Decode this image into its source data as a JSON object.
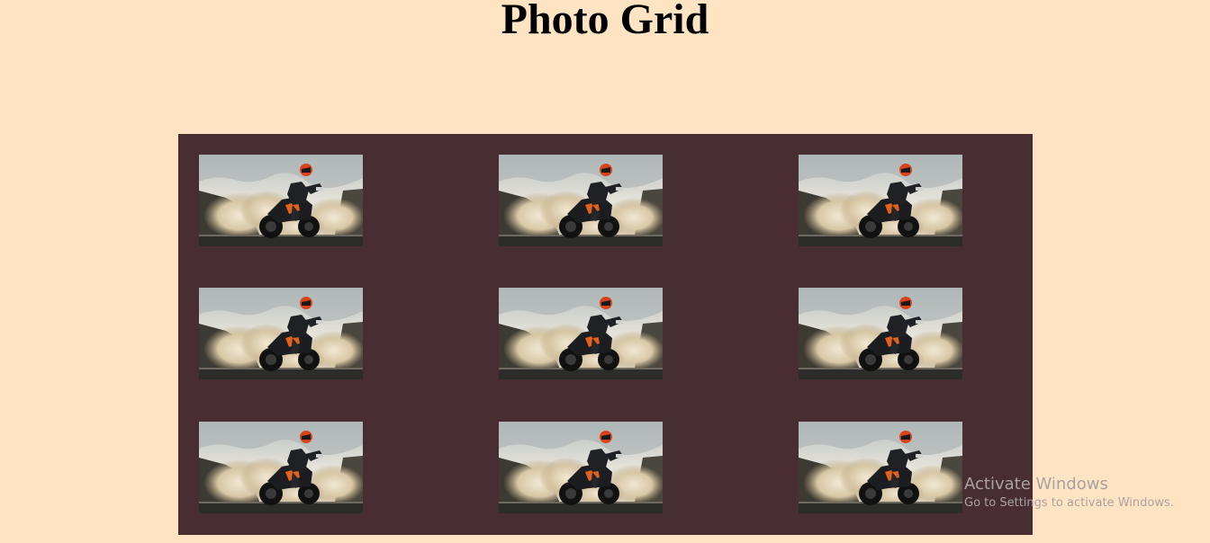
{
  "header": {
    "title": "Photo Grid"
  },
  "grid": {
    "background": "#482e32",
    "rows": 3,
    "columns": 3,
    "photo_count": 9,
    "photo_subject": "motorcycle-rider-burnout-image"
  },
  "watermark": {
    "title": "Activate Windows",
    "subtitle": "Go to Settings to activate Windows."
  },
  "colors": {
    "page_background": "#ffe4c4",
    "grid_background": "#482e32",
    "watermark_text": "#a9a2a0"
  }
}
